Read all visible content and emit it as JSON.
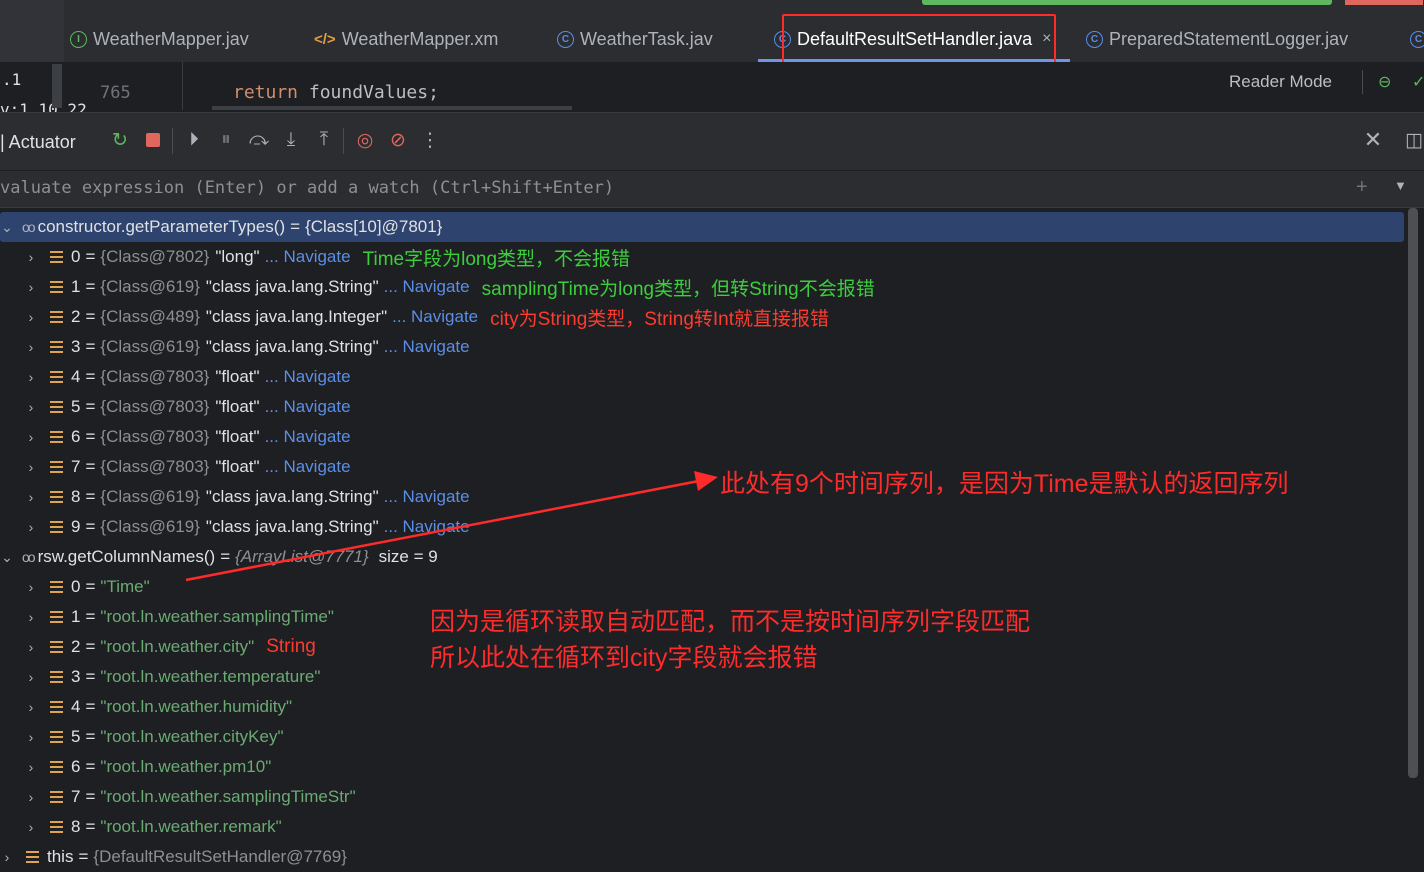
{
  "tabs": [
    {
      "label": "WeatherMapper.jav",
      "icon": "interface-icon",
      "active": false
    },
    {
      "label": "WeatherMapper.xm",
      "icon": "xml-icon",
      "active": false
    },
    {
      "label": "WeatherTask.jav",
      "icon": "class-icon",
      "active": false
    },
    {
      "label": "DefaultResultSetHandler.java",
      "icon": "class-icon",
      "active": true
    },
    {
      "label": "PreparedStatementLogger.jav",
      "icon": "class-icon",
      "active": false
    }
  ],
  "left_panel": {
    "line1": ".1",
    "line2": "v:1.10.22"
  },
  "editor": {
    "line_number": "765",
    "code_keyword": "return",
    "code_rest": "foundValues;",
    "reader_mode": "Reader Mode"
  },
  "debugger": {
    "title": "| Actuator",
    "expr_placeholder": "valuate expression (Enter) or add a watch (Ctrl+Shift+Enter)"
  },
  "tree": {
    "param_types": {
      "name": "constructor.getParameterTypes()",
      "value": "{Class[10]@7801}"
    },
    "param_items": [
      {
        "idx": "0",
        "ref": "{Class@7802}",
        "val": "\"long\"",
        "nav": "... Navigate",
        "note": "Time字段为long类型，不会报错",
        "note_color": "green"
      },
      {
        "idx": "1",
        "ref": "{Class@619}",
        "val": "\"class java.lang.String\"",
        "nav": "... Navigate",
        "note": "samplingTime为long类型，但转String不会报错",
        "note_color": "green"
      },
      {
        "idx": "2",
        "ref": "{Class@489}",
        "val": "\"class java.lang.Integer\"",
        "nav": "... Navigate",
        "note": "city为String类型，String转Int就直接报错",
        "note_color": "red"
      },
      {
        "idx": "3",
        "ref": "{Class@619}",
        "val": "\"class java.lang.String\"",
        "nav": "... Navigate",
        "note": "",
        "note_color": ""
      },
      {
        "idx": "4",
        "ref": "{Class@7803}",
        "val": "\"float\"",
        "nav": "... Navigate",
        "note": "",
        "note_color": ""
      },
      {
        "idx": "5",
        "ref": "{Class@7803}",
        "val": "\"float\"",
        "nav": "... Navigate",
        "note": "",
        "note_color": ""
      },
      {
        "idx": "6",
        "ref": "{Class@7803}",
        "val": "\"float\"",
        "nav": "... Navigate",
        "note": "",
        "note_color": ""
      },
      {
        "idx": "7",
        "ref": "{Class@7803}",
        "val": "\"float\"",
        "nav": "... Navigate",
        "note": "",
        "note_color": ""
      },
      {
        "idx": "8",
        "ref": "{Class@619}",
        "val": "\"class java.lang.String\"",
        "nav": "... Navigate",
        "note": "",
        "note_color": ""
      },
      {
        "idx": "9",
        "ref": "{Class@619}",
        "val": "\"class java.lang.String\"",
        "nav": "... Navigate",
        "note": "",
        "note_color": ""
      }
    ],
    "column_names": {
      "name": "rsw.getColumnNames()",
      "ref": "{ArrayList@7771}",
      "size": "size = 9"
    },
    "column_items": [
      {
        "idx": "0",
        "val": "\"Time\"",
        "note": ""
      },
      {
        "idx": "1",
        "val": "\"root.ln.weather.samplingTime\"",
        "note": ""
      },
      {
        "idx": "2",
        "val": "\"root.ln.weather.city\"",
        "note": "String"
      },
      {
        "idx": "3",
        "val": "\"root.ln.weather.temperature\"",
        "note": ""
      },
      {
        "idx": "4",
        "val": "\"root.ln.weather.humidity\"",
        "note": ""
      },
      {
        "idx": "5",
        "val": "\"root.ln.weather.cityKey\"",
        "note": ""
      },
      {
        "idx": "6",
        "val": "\"root.ln.weather.pm10\"",
        "note": ""
      },
      {
        "idx": "7",
        "val": "\"root.ln.weather.samplingTimeStr\"",
        "note": ""
      },
      {
        "idx": "8",
        "val": "\"root.ln.weather.remark\"",
        "note": ""
      }
    ],
    "this_row": {
      "name": "this",
      "value": "{DefaultResultSetHandler@7769}"
    }
  },
  "annotations": {
    "arrow_note": "此处有9个时间序列，是因为Time是默认的返回序列",
    "loop_note_1": "因为是循环读取自动匹配，而不是按时间序列字段匹配",
    "loop_note_2": "所以此处在循环到city字段就会报错"
  },
  "colors": {
    "annotation_red": "#ff2b2b",
    "annotation_green": "#3ccf3c",
    "navigate_blue": "#5b8ee6",
    "string_green": "#6aab73"
  }
}
